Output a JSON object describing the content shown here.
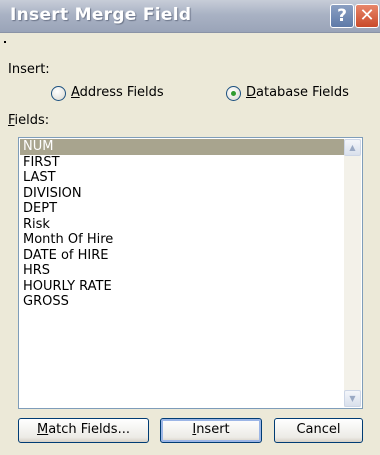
{
  "window": {
    "title": "Insert Merge Field",
    "help_icon": "?",
    "close_icon": "✕"
  },
  "insert_group": {
    "label_prefix": "Insert:",
    "options": [
      {
        "pre": "",
        "accel": "A",
        "post": "ddress Fields",
        "selected": false
      },
      {
        "pre": "",
        "accel": "D",
        "post": "atabase Fields",
        "selected": true
      }
    ]
  },
  "fields_label": {
    "accel": "F",
    "post": "ields:"
  },
  "fields": [
    "NUM",
    "FIRST",
    "LAST",
    "DIVISION",
    "DEPT",
    "Risk",
    "Month Of Hire",
    "DATE of HIRE",
    "HRS",
    "HOURLY RATE",
    "GROSS"
  ],
  "selected_field": "NUM",
  "buttons": {
    "match": {
      "accel": "M",
      "post": "atch Fields..."
    },
    "insert": {
      "accel": "I",
      "post": "nsert"
    },
    "cancel": "Cancel"
  },
  "colors": {
    "selection": "#a8a48e",
    "dialog_bg": "#ece9d8"
  }
}
